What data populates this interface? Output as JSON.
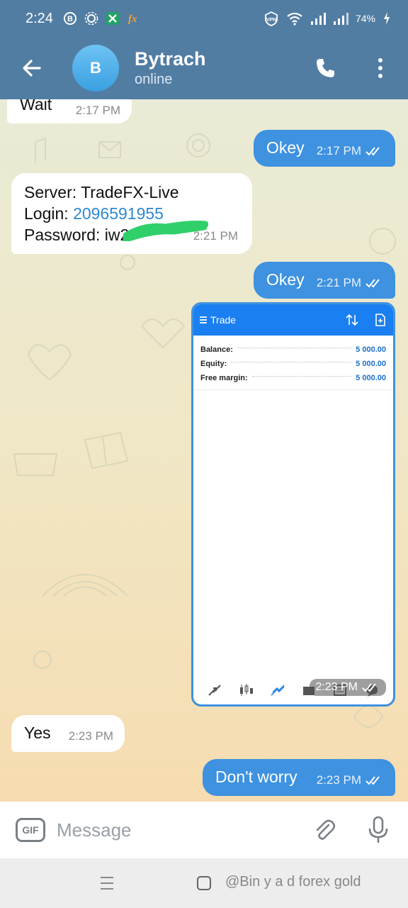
{
  "status_bar": {
    "time": "2:24",
    "app_icons": [
      "b-badge-icon",
      "gear-like-icon",
      "excel-icon",
      "fx-icon"
    ],
    "vpn_label": "VPN",
    "battery": "74%"
  },
  "header": {
    "avatar_letter": "B",
    "name": "Bytrach",
    "status": "online"
  },
  "messages": [
    {
      "id": "m1",
      "side": "in",
      "text": "Wait",
      "time": "2:17 PM"
    },
    {
      "id": "m2",
      "side": "out",
      "text": "Okey",
      "time": "2:17 PM"
    },
    {
      "id": "m3",
      "side": "in",
      "server_line": "Server: TradeFX-Live",
      "login_label": "Login: ",
      "login_value": "2096591955",
      "password_line": "Password: iw2",
      "time": "2:21 PM"
    },
    {
      "id": "m4",
      "side": "out",
      "text": "Okey",
      "time": "2:21 PM"
    },
    {
      "id": "m5",
      "side": "out",
      "type": "image",
      "time": "2:23 PM"
    },
    {
      "id": "m6",
      "side": "in",
      "text": "Yes",
      "time": "2:23 PM"
    },
    {
      "id": "m7",
      "side": "out",
      "text": "Don't worry",
      "time": "2:23 PM"
    }
  ],
  "trade_screen": {
    "title": "Trade",
    "rows": [
      {
        "label": "Balance:",
        "value": "5 000.00"
      },
      {
        "label": "Equity:",
        "value": "5 000.00"
      },
      {
        "label": "Free margin:",
        "value": "5 000.00"
      }
    ]
  },
  "input": {
    "gif_label": "GIF",
    "placeholder": "Message"
  },
  "nav": {
    "watermark": "@Bin y a d forex gold"
  },
  "colors": {
    "header": "#527da3",
    "outgoing_bubble": "#3e92e0",
    "incoming_bubble": "#ffffff",
    "trade_bar": "#1a7ff0"
  }
}
